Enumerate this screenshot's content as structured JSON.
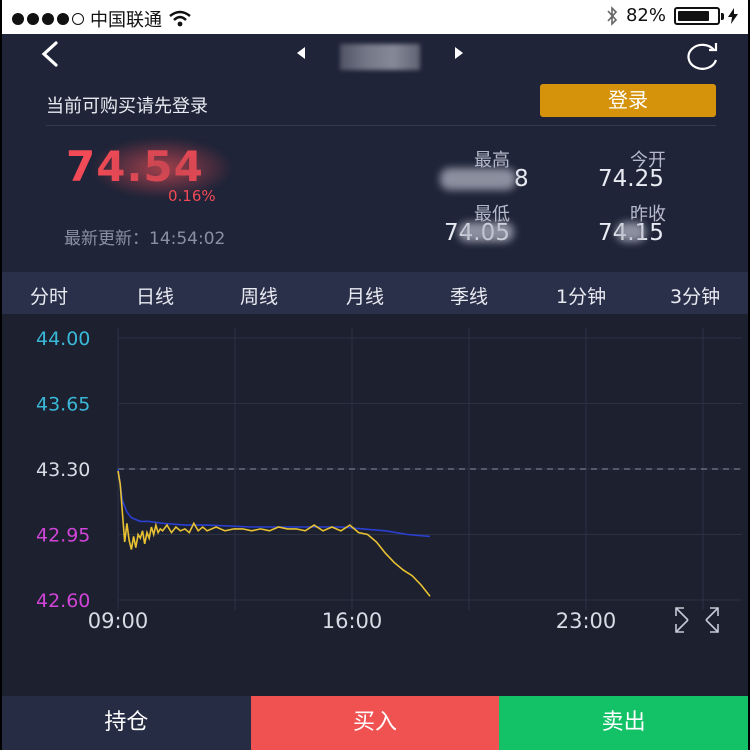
{
  "status_bar": {
    "carrier": "中国联通",
    "battery": "82%",
    "battery_level": 0.82,
    "icons": [
      "signal-dots",
      "wifi-icon",
      "bluetooth-icon",
      "battery-icon",
      "charging-icon"
    ]
  },
  "nav": {
    "icons": [
      "back-icon",
      "prev-arrow-icon",
      "next-arrow-icon",
      "refresh-icon"
    ]
  },
  "login": {
    "hint": "当前可购买请先登录",
    "button": "登录"
  },
  "quote": {
    "price": "74.54",
    "change": "0.16%",
    "updated_label": "最新更新：",
    "updated_time": "14:54:02",
    "high_label": "最高",
    "high_value": "8",
    "open_label": "今开",
    "open_value": "74.25",
    "low_label": "最低",
    "low_value": "74.05",
    "prev_close_label": "昨收",
    "prev_close_value": "74.15"
  },
  "tabs": [
    "分时",
    "日线",
    "周线",
    "月线",
    "季线",
    "1分钟",
    "3分钟"
  ],
  "active_tab": "分时",
  "chart_data": {
    "type": "line",
    "yticks": [
      "44.00",
      "43.65",
      "43.30",
      "42.95",
      "42.60"
    ],
    "ylim": [
      42.6,
      44.0
    ],
    "reference_line": 43.3,
    "xticks": [
      "09:00",
      "16:00",
      "23:00"
    ],
    "series": [
      {
        "color": "#e8c233",
        "x": [
          0,
          0.05,
          0.1,
          0.15,
          0.2,
          0.25,
          0.3,
          0.35,
          0.4,
          0.45,
          0.5,
          0.55,
          0.6,
          0.65,
          0.7,
          0.75,
          0.8,
          0.85,
          0.9,
          0.95,
          1.0,
          1.1,
          1.2,
          1.3,
          1.4,
          1.5,
          1.6,
          1.7,
          1.8,
          1.9,
          2.0,
          2.2,
          2.4,
          2.6,
          2.8,
          3.0,
          3.2,
          3.4,
          3.6,
          3.8,
          4.0,
          4.2,
          4.4,
          4.6,
          4.8,
          5.0,
          5.2,
          5.4,
          5.6,
          5.8,
          6.0,
          6.2,
          6.4,
          6.6,
          6.8,
          7.0
        ],
        "y": [
          43.29,
          43.22,
          43.06,
          42.91,
          43.01,
          42.92,
          42.87,
          42.94,
          42.88,
          42.95,
          42.93,
          42.97,
          42.9,
          42.96,
          42.93,
          42.99,
          42.95,
          43.0,
          42.96,
          42.98,
          42.97,
          43.0,
          42.96,
          42.99,
          42.97,
          42.98,
          42.96,
          43.01,
          42.97,
          42.99,
          42.97,
          42.99,
          42.97,
          42.98,
          42.98,
          42.97,
          42.98,
          42.97,
          42.99,
          42.98,
          42.98,
          42.97,
          43.0,
          42.97,
          42.99,
          42.97,
          43.0,
          42.96,
          42.95,
          42.91,
          42.85,
          42.8,
          42.76,
          42.73,
          42.68,
          42.62
        ]
      },
      {
        "color": "#2a3fd0",
        "x": [
          0,
          0.1,
          0.2,
          0.3,
          0.5,
          0.7,
          1.0,
          1.5,
          2.0,
          3.0,
          4.0,
          5.0,
          5.5,
          6.0,
          6.5,
          7.0
        ],
        "y": [
          43.3,
          43.13,
          43.07,
          43.04,
          43.02,
          43.02,
          43.01,
          43.0,
          43.0,
          42.99,
          42.99,
          42.99,
          42.98,
          42.97,
          42.95,
          42.94
        ]
      }
    ],
    "x_range": [
      0,
      14
    ]
  },
  "bottom_buttons": {
    "hold": "持仓",
    "buy": "买入",
    "sell": "卖出"
  }
}
